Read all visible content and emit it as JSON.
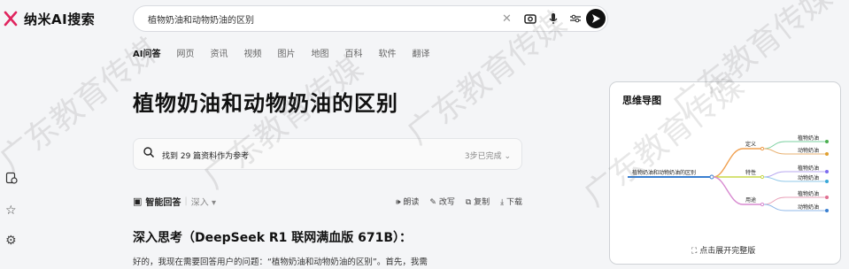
{
  "brand": {
    "name": "纳米AI搜索"
  },
  "search": {
    "query": "植物奶油和动物奶油的区别"
  },
  "tabs": [
    {
      "label": "AI问答",
      "active": true
    },
    {
      "label": "网页"
    },
    {
      "label": "资讯"
    },
    {
      "label": "视频"
    },
    {
      "label": "图片"
    },
    {
      "label": "地图"
    },
    {
      "label": "百科"
    },
    {
      "label": "软件"
    },
    {
      "label": "翻译"
    }
  ],
  "page": {
    "title": "植物奶油和动物奶油的区别"
  },
  "sources": {
    "label": "找到 29 篇资料作为参考",
    "status": "3步已完成"
  },
  "answer": {
    "mode_label": "智能回答",
    "depth_label": "深入",
    "tools": [
      "朗读",
      "改写",
      "复制",
      "下载"
    ]
  },
  "deep": {
    "heading": "深入思考（DeepSeek R1 联网满血版 671B）：",
    "text": "好的，我现在需要回答用户的问题：“植物奶油和动物奶油的区别”。首先，我需"
  },
  "mindmap": {
    "title": "思维导图",
    "root": "植物奶油和动物奶油的区别",
    "branches": [
      {
        "label": "定义",
        "color": "#f0a050",
        "children": [
          "植物奶油",
          "动物奶油"
        ]
      },
      {
        "label": "特性",
        "color": "#c8d84a",
        "children": [
          "植物奶油",
          "动物奶油"
        ]
      },
      {
        "label": "用途",
        "color": "#d88ad0",
        "children": [
          "植物奶油",
          "动物奶油"
        ]
      }
    ],
    "leaf_colors": [
      "#4caf50",
      "#e0a030",
      "#7c6cf0",
      "#38a8d8",
      "#e07090",
      "#3a7fd0"
    ],
    "expand_label": "点击展开完整版"
  },
  "watermark": "广东教育传媒",
  "colors": {
    "accent": "#111111",
    "root_line": "#3a7fd0"
  }
}
